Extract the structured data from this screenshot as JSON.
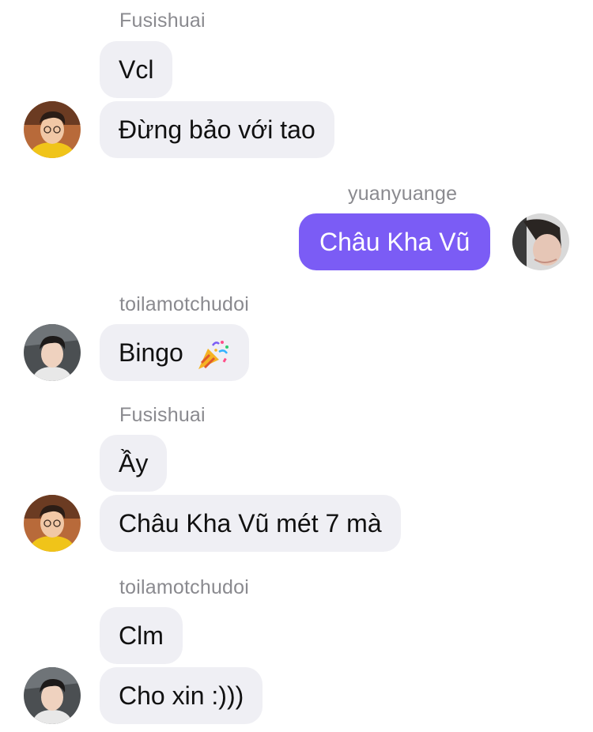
{
  "messages": [
    {
      "sender": "Fusishuai",
      "texts": [
        "Vcl",
        "Đừng bảo với tao"
      ]
    },
    {
      "sender": "yuanyuange",
      "texts": [
        "Châu Kha Vũ"
      ]
    },
    {
      "sender": "toilamotchudoi",
      "texts": [
        "Bingo"
      ],
      "emoji": "party-popper-icon"
    },
    {
      "sender": "Fusishuai",
      "texts": [
        "Ầy",
        "Châu Kha Vũ mét 7 mà"
      ]
    },
    {
      "sender": "toilamotchudoi",
      "texts": [
        "Clm",
        "Cho xin :)))"
      ]
    }
  ],
  "colors": {
    "outgoing_bubble": "#7b5cf5",
    "incoming_bubble": "#efeff4",
    "sender_name": "#8a8a8f"
  }
}
